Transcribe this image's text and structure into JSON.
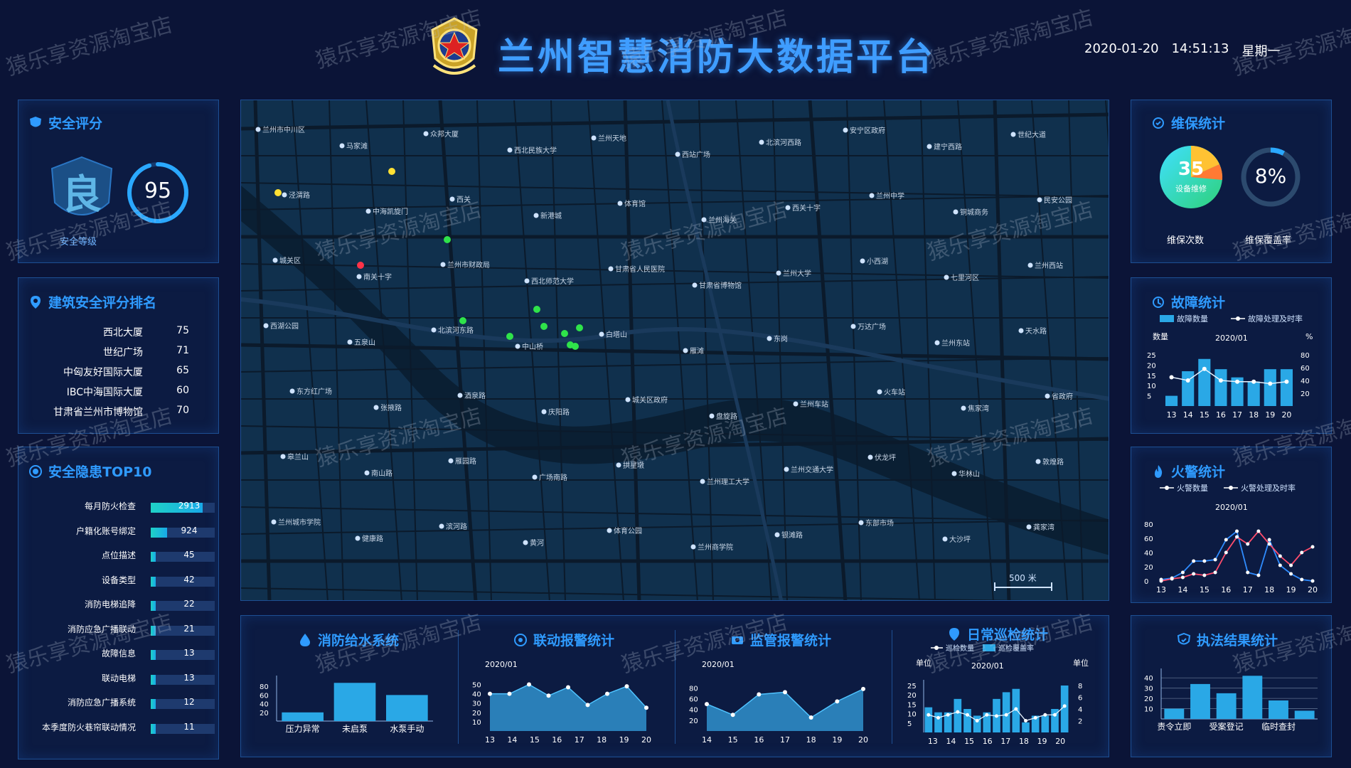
{
  "header": {
    "title": "兰州智慧消防大数据平台",
    "date": "2020-01-20",
    "time": "14:51:13",
    "weekday": "星期一"
  },
  "watermark": "猿乐享资源淘宝店",
  "safety_score": {
    "title": "安全评分",
    "grade": "良",
    "grade_label": "安全等级",
    "score": "95",
    "score_fraction": 0.95
  },
  "building_rank": {
    "title": "建筑安全评分排名",
    "items": [
      {
        "name": "西北大厦",
        "value": "75"
      },
      {
        "name": "世纪广场",
        "value": "71"
      },
      {
        "name": "中匈友好国际大厦",
        "value": "65"
      },
      {
        "name": "IBC中海国际大厦",
        "value": "60"
      },
      {
        "name": "甘肃省兰州市博物馆",
        "value": "70"
      }
    ]
  },
  "hazard_top10": {
    "title": "安全隐患TOP10",
    "items": [
      {
        "name": "每月防火检查",
        "value": 2913,
        "label": "2913"
      },
      {
        "name": "户籍化账号绑定",
        "value": 924,
        "label": "924"
      },
      {
        "name": "点位描述",
        "value": 45,
        "label": "45"
      },
      {
        "name": "设备类型",
        "value": 42,
        "label": "42"
      },
      {
        "name": "消防电梯追降",
        "value": 22,
        "label": "22"
      },
      {
        "name": "消防应急广播联动",
        "value": 21,
        "label": "21"
      },
      {
        "name": "故障信息",
        "value": 13,
        "label": "13"
      },
      {
        "name": "联动电梯",
        "value": 13,
        "label": "13"
      },
      {
        "name": "消防应急广播系统",
        "value": 12,
        "label": "12"
      },
      {
        "name": "本季度防火巷帘联动情况",
        "value": 11,
        "label": "11"
      }
    ]
  },
  "map": {
    "scale_label": "500 米",
    "labels": [
      "兰州市中川区",
      "马家滩",
      "众邦大厦",
      "西北民族大学",
      "兰州天地",
      "西站广场",
      "北滨河西路",
      "安宁区政府",
      "建宁西路",
      "世纪大道",
      "泾渭路",
      "中海凯旋门",
      "西关",
      "新港城",
      "体育馆",
      "兰州海关",
      "西关十字",
      "兰州中学",
      "铜城商务",
      "民安公园",
      "城关区",
      "南关十字",
      "兰州市财政局",
      "西北师范大学",
      "甘肃省人民医院",
      "甘肃省博物馆",
      "兰州大学",
      "小西湖",
      "七里河区",
      "兰州西站",
      "西湖公园",
      "五泉山",
      "北滨河东路",
      "中山桥",
      "白塔山",
      "雁滩",
      "东岗",
      "万达广场",
      "兰州东站",
      "天水路",
      "东方红广场",
      "张掖路",
      "酒泉路",
      "庆阳路",
      "城关区政府",
      "盘旋路",
      "兰州车站",
      "火车站",
      "焦家湾",
      "省政府",
      "皋兰山",
      "南山路",
      "雁园路",
      "广场南路",
      "拱星墩",
      "兰州理工大学",
      "兰州交通大学",
      "伏龙坪",
      "华林山",
      "敦煌路",
      "兰州城市学院",
      "健康路",
      "滨河路",
      "黄河",
      "体育公园",
      "兰州商学院",
      "银滩路",
      "东部市场",
      "大沙坪",
      "龚家湾"
    ],
    "dots": [
      {
        "c": "#ffe033"
      },
      {
        "c": "#ffe033"
      },
      {
        "c": "#2fe34a"
      },
      {
        "c": "#ff3348"
      },
      {
        "c": "#2fe34a"
      },
      {
        "c": "#2fe34a"
      },
      {
        "c": "#2fe34a"
      },
      {
        "c": "#2fe34a"
      },
      {
        "c": "#2fe34a"
      },
      {
        "c": "#2fe34a"
      },
      {
        "c": "#2fe34a"
      },
      {
        "c": "#2fe34a"
      }
    ]
  },
  "maintenance": {
    "title": "维保统计",
    "count": "35",
    "count_sub": "设备维修",
    "count_label": "维保次数",
    "coverage": "8%",
    "coverage_value": 0.08,
    "coverage_label": "维保覆盖率"
  },
  "fault": {
    "title": "故障统计",
    "legend_bar": "故障数量",
    "legend_line": "故障处理及时率",
    "month": "2020/01",
    "left_unit": "数量",
    "right_unit": "%",
    "chart_data": {
      "type": "bar",
      "x": [
        "13",
        "14",
        "15",
        "16",
        "17",
        "18",
        "19",
        "20"
      ],
      "y_ticks": [
        "25",
        "20",
        "15",
        "10",
        "5"
      ],
      "y2_ticks": [
        "80",
        "60",
        "40",
        "20"
      ],
      "ylim": [
        0,
        25
      ],
      "y2lim": [
        0,
        80
      ],
      "series": [
        {
          "name": "故障数量",
          "values": [
            5,
            17,
            23,
            18,
            14,
            12,
            18,
            18
          ]
        },
        {
          "name": "故障处理及时率",
          "values": [
            45,
            40,
            58,
            40,
            38,
            38,
            35,
            38
          ]
        }
      ]
    }
  },
  "fire": {
    "title": "火警统计",
    "legend_a": "火警数量",
    "legend_b": "火警处理及时率",
    "month": "2020/01",
    "chart_data": {
      "type": "line",
      "x": [
        "13",
        "14",
        "15",
        "16",
        "17",
        "18",
        "19",
        "20"
      ],
      "y_ticks": [
        "80",
        "60",
        "40",
        "20",
        "0"
      ],
      "ylim": [
        0,
        80
      ],
      "series": [
        {
          "name": "火警数量",
          "values": [
            2,
            4,
            12,
            28,
            28,
            30,
            58,
            70,
            12,
            8,
            58,
            22,
            10,
            2,
            0
          ]
        },
        {
          "name": "火警处理及时率",
          "values": [
            0,
            3,
            5,
            10,
            8,
            12,
            40,
            62,
            52,
            70,
            52,
            35,
            22,
            40,
            48
          ]
        }
      ]
    }
  },
  "water": {
    "title": "消防给水系统",
    "chart_data": {
      "type": "bar",
      "categories": [
        "压力异常",
        "未启泵",
        "水泵手动"
      ],
      "values": [
        20,
        88,
        60
      ],
      "y_ticks": [
        "80",
        "60",
        "40",
        "20"
      ],
      "ylim": [
        0,
        95
      ]
    }
  },
  "linkage": {
    "title": "联动报警统计",
    "month": "2020/01",
    "chart_data": {
      "type": "area",
      "x": [
        "13",
        "14",
        "15",
        "16",
        "17",
        "18",
        "19",
        "20"
      ],
      "y_ticks": [
        "50",
        "40",
        "30",
        "20",
        "10"
      ],
      "ylim": [
        0,
        55
      ],
      "values": [
        40,
        40,
        50,
        38,
        47,
        28,
        40,
        48,
        25
      ]
    }
  },
  "supervise": {
    "title": "监管报警统计",
    "month": "2020/01",
    "chart_data": {
      "type": "area",
      "x": [
        "14",
        "15",
        "16",
        "17",
        "18",
        "19",
        "20"
      ],
      "y_ticks": [
        "80",
        "60",
        "40",
        "20"
      ],
      "ylim": [
        0,
        95
      ],
      "values": [
        50,
        30,
        68,
        72,
        25,
        55,
        78
      ]
    }
  },
  "patrol": {
    "title": "日常巡检统计",
    "legend_line": "巡检数量",
    "legend_bar": "巡检覆盖率",
    "month": "2020/01",
    "left_unit": "单位",
    "right_unit": "单位",
    "chart_data": {
      "type": "bar",
      "x": [
        "13",
        "14",
        "15",
        "16",
        "17",
        "18",
        "19",
        "20"
      ],
      "y_ticks": [
        "25",
        "20",
        "15",
        "10",
        "5"
      ],
      "y2_ticks": [
        "8",
        "6",
        "4",
        "2"
      ],
      "series": [
        {
          "name": "巡检覆盖率",
          "values": [
            15,
            12,
            12,
            20,
            14,
            10,
            12,
            20,
            24,
            26,
            6,
            10,
            10,
            14,
            28
          ]
        },
        {
          "name": "巡检数量",
          "values": [
            3,
            2.5,
            3,
            3.5,
            3,
            2,
            3,
            2.8,
            3,
            4,
            2,
            2.5,
            3,
            3,
            4.5
          ]
        }
      ]
    }
  },
  "enforcement": {
    "title": "执法结果统计",
    "chart_data": {
      "type": "bar",
      "categories": [
        "责令立即",
        "",
        "受案登记",
        "",
        "临时查封",
        ""
      ],
      "values": [
        10,
        34,
        25,
        42,
        18,
        8
      ],
      "y_ticks": [
        "40",
        "30",
        "20",
        "10"
      ],
      "ylim": [
        0,
        45
      ]
    }
  }
}
